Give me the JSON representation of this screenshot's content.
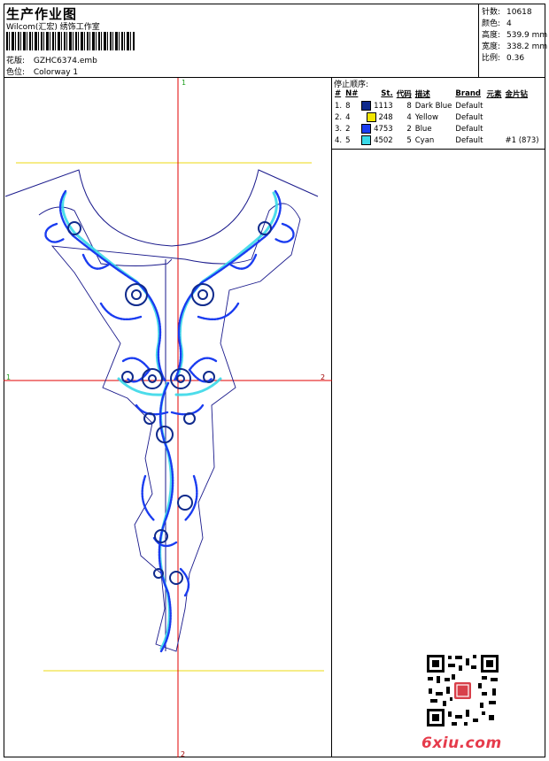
{
  "header": {
    "title": "生产作业图",
    "subtitle": "Wilcom(汇宏) 绣饰工作室",
    "design_label": "花版:",
    "design_value": "GZHC6374.emb",
    "colorway_label": "色位:",
    "colorway_value": "Colorway 1"
  },
  "stats": [
    {
      "label": "针数:",
      "value": "10618"
    },
    {
      "label": "颜色:",
      "value": "4"
    },
    {
      "label": "高度:",
      "value": "539.9 mm"
    },
    {
      "label": "宽度:",
      "value": "338.2 mm"
    },
    {
      "label": "比例:",
      "value": "0.36"
    }
  ],
  "canvas": {
    "h_label_left": "1",
    "h_label_right": "2",
    "v_label_top": "1",
    "v_label_bottom": "2"
  },
  "panel": {
    "title": "停止顺序:",
    "columns": [
      "#",
      "N#",
      "St.",
      "代码",
      "描述",
      "Brand",
      "元素",
      "金片钻"
    ],
    "rows": [
      {
        "n": "1.",
        "needle": "8",
        "color": "#0f2a8c",
        "st": "1113",
        "code": "8",
        "desc": "Dark Blue",
        "brand": "Default",
        "el": "",
        "seq": ""
      },
      {
        "n": "2.",
        "needle": "4",
        "color": "#f2e600",
        "st": "248",
        "code": "4",
        "desc": "Yellow",
        "brand": "Default",
        "el": "",
        "seq": ""
      },
      {
        "n": "3.",
        "needle": "2",
        "color": "#1a3cf0",
        "st": "4753",
        "code": "2",
        "desc": "Blue",
        "brand": "Default",
        "el": "",
        "seq": ""
      },
      {
        "n": "4.",
        "needle": "5",
        "color": "#39d9e8",
        "st": "4502",
        "code": "5",
        "desc": "Cyan",
        "brand": "Default",
        "el": "",
        "seq": "#1 (873)"
      }
    ]
  },
  "watermark": {
    "logo_text": "6xiu.com"
  },
  "colors": {
    "guide_red": "#e00000",
    "guide_yellow": "#f0e040",
    "outline": "#1a1a8c",
    "stitch_blue": "#1a3cf0",
    "stitch_dark": "#0f2a8c",
    "stitch_cyan": "#39d9e8"
  }
}
